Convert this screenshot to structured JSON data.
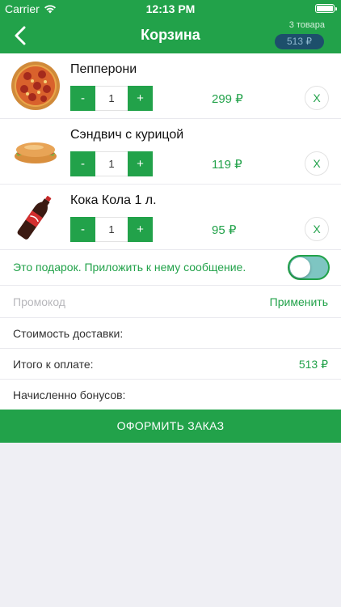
{
  "status_bar": {
    "carrier": "Carrier",
    "time": "12:13 PM"
  },
  "nav": {
    "title": "Корзина",
    "cart_count": "3 товара",
    "cart_total": "513 ₽"
  },
  "items": [
    {
      "name": "Пепперони",
      "minus": "-",
      "qty": "1",
      "plus": "+",
      "price": "299 ₽",
      "remove": "X",
      "image": "pizza-image"
    },
    {
      "name": "Сэндвич с курицой",
      "minus": "-",
      "qty": "1",
      "plus": "+",
      "price": "119 ₽",
      "remove": "X",
      "image": "sandwich-image"
    },
    {
      "name": "Кока Кола 1 л.",
      "minus": "-",
      "qty": "1",
      "plus": "+",
      "price": "95 ₽",
      "remove": "X",
      "image": "cola-bottle-image"
    }
  ],
  "gift": {
    "text": "Это подарок. Приложить к нему сообщение.",
    "enabled": false
  },
  "promo": {
    "placeholder": "Промокод",
    "value": "",
    "apply_label": "Применить"
  },
  "summary": {
    "delivery_label": "Стоимость доставки:",
    "delivery_value": "",
    "total_label": "Итого к оплате:",
    "total_value": "513 ₽",
    "bonus_label": "Начисленно бонусов:",
    "bonus_value": ""
  },
  "checkout_label": "ОФОРМИТЬ ЗАКАЗ",
  "colors": {
    "accent": "#22a24a",
    "badge_bg": "#1d4f6b",
    "background": "#efeff4"
  }
}
